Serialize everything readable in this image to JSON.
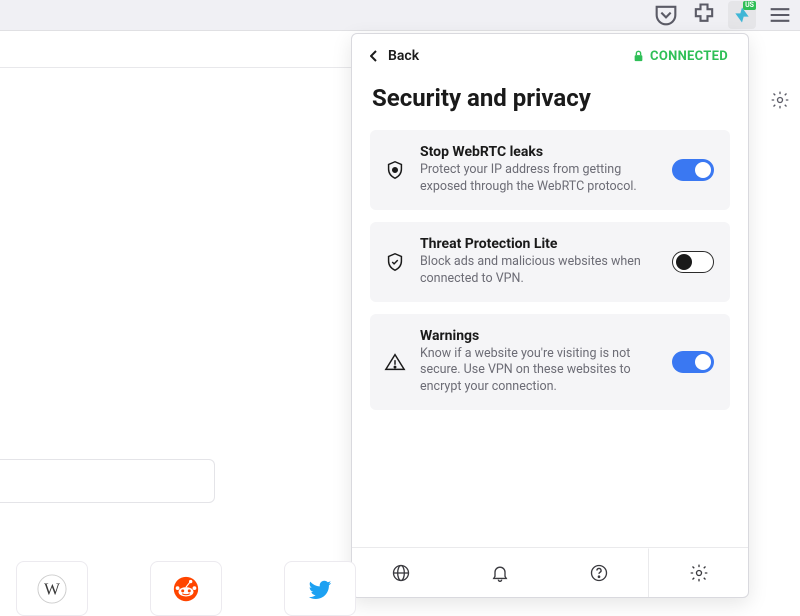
{
  "toolbar": {
    "ext_country": "US"
  },
  "panel": {
    "back_label": "Back",
    "status_label": "CONNECTED",
    "title": "Security and privacy",
    "items": [
      {
        "title": "Stop WebRTC leaks",
        "desc": "Protect your IP address from getting exposed through the WebRTC protocol.",
        "on": true
      },
      {
        "title": "Threat Protection Lite",
        "desc": "Block ads and malicious websites when connected to VPN.",
        "on": false
      },
      {
        "title": "Warnings",
        "desc": "Know if a website you're visiting is not secure. Use VPN on these websites to encrypt your connection.",
        "on": true
      }
    ]
  }
}
